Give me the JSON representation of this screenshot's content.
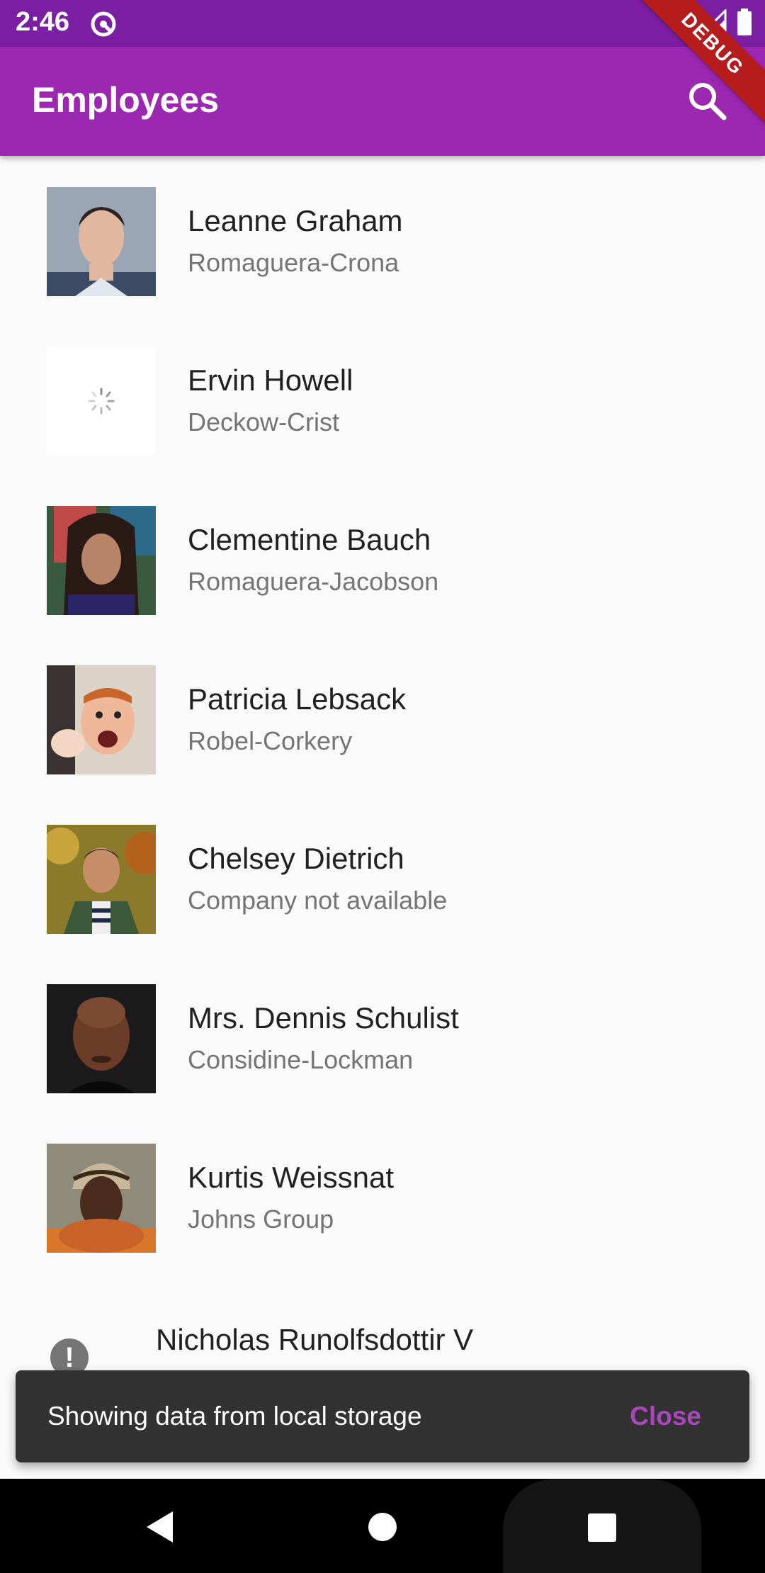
{
  "status_bar": {
    "time": "2:46",
    "icons": [
      "sync-icon",
      "wifi-icon",
      "signal-icon",
      "battery-icon"
    ]
  },
  "app_bar": {
    "title": "Employees",
    "search_icon": "search-icon",
    "background": "#9c27b0"
  },
  "debug_banner": {
    "label": "DEBUG"
  },
  "employees": [
    {
      "name": "Leanne Graham",
      "company": "Romaguera-Crona",
      "avatar": "photo"
    },
    {
      "name": "Ervin Howell",
      "company": "Deckow-Crist",
      "avatar": "loading-spinner"
    },
    {
      "name": "Clementine Bauch",
      "company": "Romaguera-Jacobson",
      "avatar": "photo"
    },
    {
      "name": "Patricia Lebsack",
      "company": "Robel-Corkery",
      "avatar": "photo"
    },
    {
      "name": "Chelsey Dietrich",
      "company": "Company not available",
      "avatar": "photo"
    },
    {
      "name": "Mrs. Dennis Schulist",
      "company": "Considine-Lockman",
      "avatar": "photo"
    },
    {
      "name": "Kurtis Weissnat",
      "company": "Johns Group",
      "avatar": "photo"
    },
    {
      "name": "Nicholas Runolfsdottir V",
      "company": "",
      "avatar": "error-icon"
    }
  ],
  "snackbar": {
    "message": "Showing data from local storage",
    "action": "Close",
    "action_color": "#ab47bc"
  },
  "nav_bar": {
    "buttons": [
      "back-icon",
      "home-icon",
      "recents-icon"
    ]
  }
}
